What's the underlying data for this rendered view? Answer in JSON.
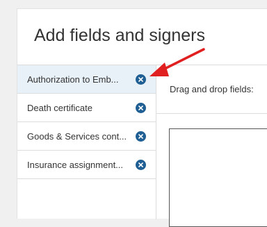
{
  "page": {
    "title": "Add fields and signers"
  },
  "documents": [
    {
      "label": "Authorization to Emb...",
      "selected": true
    },
    {
      "label": "Death certificate",
      "selected": false
    },
    {
      "label": "Goods & Services cont...",
      "selected": false
    },
    {
      "label": "Insurance assignment...",
      "selected": false
    }
  ],
  "main": {
    "drag_label": "Drag and drop fields:"
  },
  "icons": {
    "remove": "close-circle-icon",
    "annotation": "red-arrow-annotation"
  },
  "colors": {
    "accent": "#1f5f93",
    "selected_bg": "#e8f1f8",
    "annotation": "#e02020"
  }
}
